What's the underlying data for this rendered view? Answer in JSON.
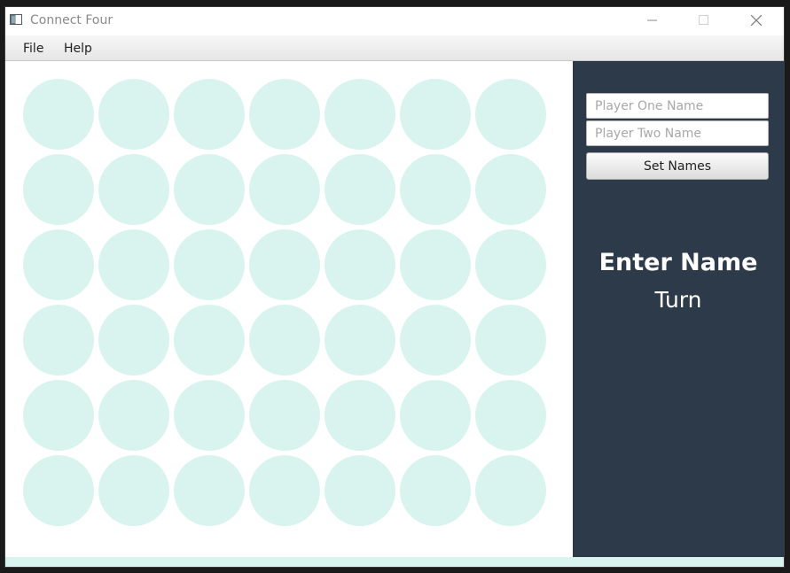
{
  "window": {
    "title": "Connect Four"
  },
  "menu": {
    "items": [
      "File",
      "Help"
    ]
  },
  "board": {
    "rows": 6,
    "columns": 7,
    "empty_cell_color": "#d9f4ef",
    "cells": [
      [
        "empty",
        "empty",
        "empty",
        "empty",
        "empty",
        "empty",
        "empty"
      ],
      [
        "empty",
        "empty",
        "empty",
        "empty",
        "empty",
        "empty",
        "empty"
      ],
      [
        "empty",
        "empty",
        "empty",
        "empty",
        "empty",
        "empty",
        "empty"
      ],
      [
        "empty",
        "empty",
        "empty",
        "empty",
        "empty",
        "empty",
        "empty"
      ],
      [
        "empty",
        "empty",
        "empty",
        "empty",
        "empty",
        "empty",
        "empty"
      ],
      [
        "empty",
        "empty",
        "empty",
        "empty",
        "empty",
        "empty",
        "empty"
      ]
    ]
  },
  "side_panel": {
    "background_color": "#2d3a4a",
    "player_one_placeholder": "Player One Name",
    "player_two_placeholder": "Player Two Name",
    "player_one_value": "",
    "player_two_value": "",
    "set_names_label": "Set Names",
    "current_player": "Enter Name",
    "turn_label": "Turn"
  }
}
